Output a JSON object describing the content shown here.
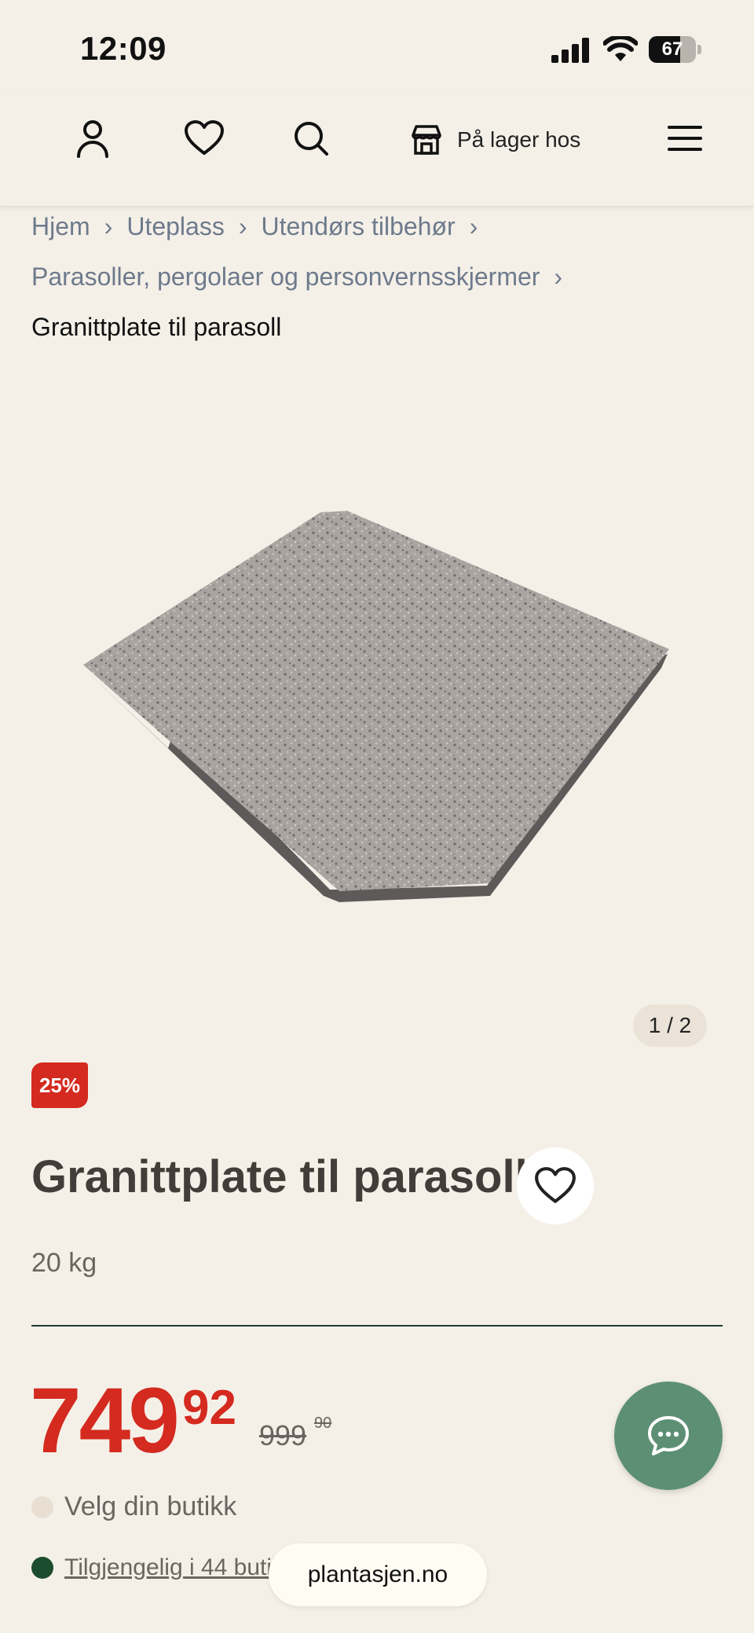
{
  "status_bar": {
    "time": "12:09",
    "battery_level": "67",
    "battery_fraction": 0.67
  },
  "header": {
    "store_label": "På lager hos"
  },
  "breadcrumb": {
    "items": [
      "Hjem",
      "Uteplass",
      "Utendørs tilbehør",
      "Parasoller, pergolaer og personvernsskjermer"
    ],
    "current": "Granittplate til parasoll",
    "separator": "›"
  },
  "gallery": {
    "pager": "1 / 2"
  },
  "product": {
    "badge": "25%",
    "title": "Granittplate til parasoll",
    "weight": "20 kg",
    "price_main": "749",
    "price_decimals": "92",
    "old_price_main": "999",
    "old_price_decimals": "90",
    "select_store": "Velg din butikk",
    "availability": "Tilgjengelig i 44 butikker"
  },
  "browser": {
    "url": "plantasjen.no"
  },
  "colors": {
    "accent_red": "#d42a1f",
    "chat_green": "#5d8f75",
    "stock_green": "#1c4d2e",
    "background": "#f4f0e8"
  }
}
